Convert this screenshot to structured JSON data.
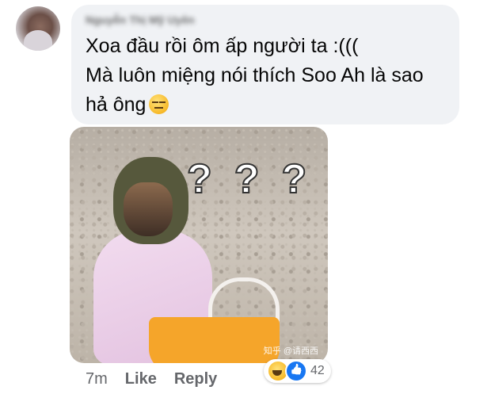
{
  "comment": {
    "author": "Nguyễn Thị Mỹ Uyên",
    "lines": [
      "Xoa đầu rồi ôm ấp người ta :(((",
      "Mà luôn miệng nói thích Soo Ah là sao",
      "hả ông"
    ],
    "emoji": "expressionless-face-icon"
  },
  "image": {
    "question_marks": [
      "?",
      "?",
      "?"
    ],
    "watermark": "知乎 @请西西"
  },
  "actions": {
    "time": "7m",
    "like_label": "Like",
    "reply_label": "Reply"
  },
  "reactions": {
    "types": [
      "haha-icon",
      "like-icon"
    ],
    "count": "42"
  }
}
